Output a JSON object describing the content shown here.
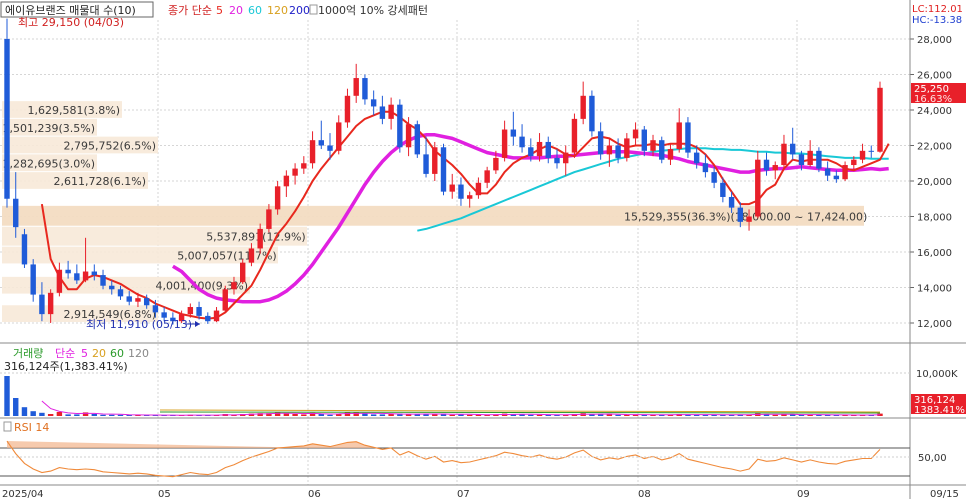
{
  "header": {
    "stock_name": "에이유브랜즈 매물대 수(10)",
    "ma_label": "종가 단순",
    "ma_periods": [
      "5",
      "20",
      "60",
      "120",
      "200"
    ],
    "ma_colors": [
      "#e8281e",
      "#e020e0",
      "#19c8d6",
      "#d8a020",
      "#2020c8"
    ],
    "pattern_label": "1000억 10% 강세패턴",
    "lc": "LC:112.01",
    "hc": "HC:-13.38"
  },
  "annotations": {
    "high": "최고 29,150 (04/03)",
    "low": "최저 11,910 (05/13)"
  },
  "price_panel": {
    "current_price": "25,250",
    "current_change": "16.63%",
    "y_ticks": [
      "28,000",
      "26,000",
      "24,000",
      "22,000",
      "20,000",
      "18,000",
      "16,000",
      "14,000",
      "12,000"
    ]
  },
  "volume_profile": [
    {
      "label": "1,629,581(3.8%)",
      "lo": 23500,
      "hi": 24500,
      "highlight": false
    },
    {
      "label": "1,501,239(3.5%)",
      "lo": 22500,
      "hi": 23500,
      "highlight": false
    },
    {
      "label": "2,795,752(6.5%)",
      "lo": 21500,
      "hi": 22500,
      "highlight": false
    },
    {
      "label": "1,282,695(3.0%)",
      "lo": 20500,
      "hi": 21500,
      "highlight": false
    },
    {
      "label": "2,611,728(6.1%)",
      "lo": 19500,
      "hi": 20500,
      "highlight": false
    },
    {
      "label": "15,529,355(36.3%)(18,000.00 ~ 17,424.00)",
      "lo": 17424,
      "hi": 18600,
      "highlight": true
    },
    {
      "label": "5,537,891(12.9%)",
      "lo": 16300,
      "hi": 17424,
      "highlight": false
    },
    {
      "label": "5,007,057(11.7%)",
      "lo": 15300,
      "hi": 16300,
      "highlight": false
    },
    {
      "label": "4,001,400(9.3%)",
      "lo": 13600,
      "hi": 14600,
      "highlight": false
    },
    {
      "label": "2,914,549(6.8%)",
      "lo": 12000,
      "hi": 13000,
      "highlight": false
    }
  ],
  "volume_panel": {
    "title": "거래량",
    "ma_label": "단순",
    "ma_periods": [
      "5",
      "20",
      "60",
      "120"
    ],
    "ma_colors": [
      "#e020e0",
      "#d8a020",
      "#2a9a2a",
      "#888888"
    ],
    "current": "316,124주(1,383.41%)",
    "y_tick": "10,000K",
    "badge_value": "316,124",
    "badge_pct": "1383.41%"
  },
  "rsi_panel": {
    "title": "RSI 14",
    "y_tick": "50,00"
  },
  "x_axis": {
    "labels": [
      "2025/04",
      "05",
      "06",
      "07",
      "08",
      "09",
      "09/15"
    ]
  },
  "chart_data": {
    "type": "candlestick",
    "price_ylim": [
      11000,
      29500
    ],
    "candles": [
      {
        "o": 28000,
        "h": 29150,
        "l": 18500,
        "c": 19000
      },
      {
        "o": 19000,
        "h": 20500,
        "l": 16800,
        "c": 17400
      },
      {
        "o": 17000,
        "h": 17300,
        "l": 15100,
        "c": 15300
      },
      {
        "o": 15300,
        "h": 15600,
        "l": 13200,
        "c": 13600
      },
      {
        "o": 13600,
        "h": 14300,
        "l": 12100,
        "c": 12500
      },
      {
        "o": 12500,
        "h": 13900,
        "l": 12000,
        "c": 13700
      },
      {
        "o": 13700,
        "h": 15400,
        "l": 13500,
        "c": 15000
      },
      {
        "o": 15000,
        "h": 15500,
        "l": 14500,
        "c": 14800
      },
      {
        "o": 14800,
        "h": 15300,
        "l": 14200,
        "c": 14400
      },
      {
        "o": 14400,
        "h": 16800,
        "l": 14300,
        "c": 14900
      },
      {
        "o": 14900,
        "h": 15300,
        "l": 14400,
        "c": 14700
      },
      {
        "o": 14700,
        "h": 15000,
        "l": 13900,
        "c": 14100
      },
      {
        "o": 14100,
        "h": 14400,
        "l": 13600,
        "c": 13900
      },
      {
        "o": 13900,
        "h": 14100,
        "l": 13300,
        "c": 13500
      },
      {
        "o": 13500,
        "h": 13800,
        "l": 13000,
        "c": 13200
      },
      {
        "o": 13200,
        "h": 13700,
        "l": 12900,
        "c": 13400
      },
      {
        "o": 13400,
        "h": 13600,
        "l": 12800,
        "c": 13000
      },
      {
        "o": 13000,
        "h": 13300,
        "l": 12300,
        "c": 12600
      },
      {
        "o": 12600,
        "h": 12900,
        "l": 12100,
        "c": 12300
      },
      {
        "o": 12300,
        "h": 12600,
        "l": 11910,
        "c": 12100
      },
      {
        "o": 12100,
        "h": 12700,
        "l": 12000,
        "c": 12500
      },
      {
        "o": 12500,
        "h": 13100,
        "l": 12300,
        "c": 12900
      },
      {
        "o": 12900,
        "h": 13200,
        "l": 12200,
        "c": 12400
      },
      {
        "o": 12400,
        "h": 12600,
        "l": 11950,
        "c": 12100
      },
      {
        "o": 12100,
        "h": 12900,
        "l": 12050,
        "c": 12700
      },
      {
        "o": 12700,
        "h": 14100,
        "l": 12600,
        "c": 13900
      },
      {
        "o": 13900,
        "h": 14600,
        "l": 13600,
        "c": 14300
      },
      {
        "o": 14300,
        "h": 15600,
        "l": 14200,
        "c": 15400
      },
      {
        "o": 15400,
        "h": 16500,
        "l": 15200,
        "c": 16200
      },
      {
        "o": 16200,
        "h": 17600,
        "l": 15900,
        "c": 17300
      },
      {
        "o": 17300,
        "h": 18700,
        "l": 17100,
        "c": 18400
      },
      {
        "o": 18400,
        "h": 20000,
        "l": 18100,
        "c": 19700
      },
      {
        "o": 19700,
        "h": 20600,
        "l": 19100,
        "c": 20300
      },
      {
        "o": 20300,
        "h": 21000,
        "l": 19800,
        "c": 20700
      },
      {
        "o": 20700,
        "h": 21400,
        "l": 20400,
        "c": 21000
      },
      {
        "o": 21000,
        "h": 22800,
        "l": 20700,
        "c": 22300
      },
      {
        "o": 22300,
        "h": 23400,
        "l": 21800,
        "c": 22000
      },
      {
        "o": 22000,
        "h": 22700,
        "l": 21200,
        "c": 21700
      },
      {
        "o": 21700,
        "h": 23700,
        "l": 21500,
        "c": 23300
      },
      {
        "o": 23300,
        "h": 25200,
        "l": 23000,
        "c": 24800
      },
      {
        "o": 24800,
        "h": 26600,
        "l": 24400,
        "c": 25800
      },
      {
        "o": 25800,
        "h": 26000,
        "l": 24300,
        "c": 24600
      },
      {
        "o": 24600,
        "h": 25100,
        "l": 23700,
        "c": 24200
      },
      {
        "o": 24200,
        "h": 24800,
        "l": 23200,
        "c": 23500
      },
      {
        "o": 23500,
        "h": 24700,
        "l": 22900,
        "c": 24300
      },
      {
        "o": 24300,
        "h": 24600,
        "l": 21600,
        "c": 21900
      },
      {
        "o": 21900,
        "h": 23600,
        "l": 21400,
        "c": 23200
      },
      {
        "o": 23200,
        "h": 23400,
        "l": 21300,
        "c": 21500
      },
      {
        "o": 21500,
        "h": 22500,
        "l": 20200,
        "c": 20400
      },
      {
        "o": 20400,
        "h": 22200,
        "l": 20000,
        "c": 21900
      },
      {
        "o": 21900,
        "h": 22100,
        "l": 19200,
        "c": 19400
      },
      {
        "o": 19400,
        "h": 20400,
        "l": 19000,
        "c": 19800
      },
      {
        "o": 19800,
        "h": 20200,
        "l": 18600,
        "c": 19000
      },
      {
        "o": 19000,
        "h": 19400,
        "l": 18500,
        "c": 19200
      },
      {
        "o": 19200,
        "h": 20200,
        "l": 19000,
        "c": 19900
      },
      {
        "o": 19900,
        "h": 20800,
        "l": 19600,
        "c": 20600
      },
      {
        "o": 20600,
        "h": 21700,
        "l": 20400,
        "c": 21300
      },
      {
        "o": 21300,
        "h": 23400,
        "l": 21100,
        "c": 22900
      },
      {
        "o": 22900,
        "h": 23900,
        "l": 22000,
        "c": 22500
      },
      {
        "o": 22500,
        "h": 23200,
        "l": 21600,
        "c": 21900
      },
      {
        "o": 21900,
        "h": 22400,
        "l": 21100,
        "c": 21400
      },
      {
        "o": 21400,
        "h": 22700,
        "l": 21100,
        "c": 22200
      },
      {
        "o": 22200,
        "h": 22500,
        "l": 21000,
        "c": 21300
      },
      {
        "o": 21300,
        "h": 21800,
        "l": 20700,
        "c": 21000
      },
      {
        "o": 21000,
        "h": 22000,
        "l": 20300,
        "c": 21600
      },
      {
        "o": 21600,
        "h": 23800,
        "l": 21300,
        "c": 23500
      },
      {
        "o": 23500,
        "h": 25600,
        "l": 23200,
        "c": 24800
      },
      {
        "o": 24800,
        "h": 25100,
        "l": 22500,
        "c": 22800
      },
      {
        "o": 22800,
        "h": 23300,
        "l": 21200,
        "c": 21500
      },
      {
        "o": 21500,
        "h": 22400,
        "l": 20800,
        "c": 22000
      },
      {
        "o": 22000,
        "h": 22400,
        "l": 21000,
        "c": 21300
      },
      {
        "o": 21300,
        "h": 22700,
        "l": 21100,
        "c": 22400
      },
      {
        "o": 22400,
        "h": 23300,
        "l": 22000,
        "c": 22900
      },
      {
        "o": 22900,
        "h": 23100,
        "l": 21400,
        "c": 21700
      },
      {
        "o": 21700,
        "h": 22600,
        "l": 21400,
        "c": 22300
      },
      {
        "o": 22300,
        "h": 22500,
        "l": 21000,
        "c": 21200
      },
      {
        "o": 21200,
        "h": 22100,
        "l": 20900,
        "c": 21800
      },
      {
        "o": 21800,
        "h": 24100,
        "l": 21600,
        "c": 23300
      },
      {
        "o": 23300,
        "h": 23600,
        "l": 21300,
        "c": 21600
      },
      {
        "o": 21600,
        "h": 22000,
        "l": 20700,
        "c": 21000
      },
      {
        "o": 21000,
        "h": 21500,
        "l": 20200,
        "c": 20500
      },
      {
        "o": 20500,
        "h": 20800,
        "l": 19600,
        "c": 19900
      },
      {
        "o": 19900,
        "h": 20200,
        "l": 18800,
        "c": 19100
      },
      {
        "o": 19100,
        "h": 19400,
        "l": 18200,
        "c": 18500
      },
      {
        "o": 18500,
        "h": 18800,
        "l": 17400,
        "c": 17700
      },
      {
        "o": 17700,
        "h": 18400,
        "l": 17200,
        "c": 18000
      },
      {
        "o": 18000,
        "h": 21700,
        "l": 17900,
        "c": 21200
      },
      {
        "o": 21200,
        "h": 21600,
        "l": 20300,
        "c": 20600
      },
      {
        "o": 20600,
        "h": 21100,
        "l": 20100,
        "c": 20900
      },
      {
        "o": 20900,
        "h": 22600,
        "l": 20700,
        "c": 22100
      },
      {
        "o": 22100,
        "h": 23000,
        "l": 21200,
        "c": 21500
      },
      {
        "o": 21500,
        "h": 21700,
        "l": 20600,
        "c": 20900
      },
      {
        "o": 20900,
        "h": 22300,
        "l": 20800,
        "c": 21700
      },
      {
        "o": 21700,
        "h": 21900,
        "l": 20500,
        "c": 20700
      },
      {
        "o": 20700,
        "h": 21100,
        "l": 20000,
        "c": 20300
      },
      {
        "o": 20300,
        "h": 20600,
        "l": 19900,
        "c": 20100
      },
      {
        "o": 20100,
        "h": 21100,
        "l": 20000,
        "c": 20900
      },
      {
        "o": 20900,
        "h": 21400,
        "l": 20600,
        "c": 21200
      },
      {
        "o": 21200,
        "h": 22100,
        "l": 21000,
        "c": 21700
      },
      {
        "o": 21700,
        "h": 22000,
        "l": 21300,
        "c": 21650
      },
      {
        "o": 21650,
        "h": 25600,
        "l": 21600,
        "c": 25250
      }
    ],
    "ma5": [
      null,
      null,
      null,
      null,
      18700,
      15600,
      14600,
      13900,
      13900,
      14500,
      14700,
      14600,
      14400,
      14200,
      13900,
      13600,
      13400,
      13100,
      12900,
      12700,
      12500,
      12400,
      12300,
      12250,
      12300,
      12600,
      13100,
      13600,
      14100,
      15000,
      16000,
      17000,
      17600,
      18300,
      19100,
      20000,
      20700,
      21300,
      21900,
      22500,
      23100,
      23500,
      23700,
      23900,
      23900,
      23600,
      23200,
      22900,
      22400,
      21700,
      21300,
      20900,
      20400,
      19800,
      19300,
      19300,
      19800,
      20500,
      21000,
      21300,
      21500,
      21800,
      22000,
      21800,
      21500,
      21400,
      21900,
      22400,
      22500,
      22400,
      22100,
      21900,
      22000,
      22000,
      22100,
      22000,
      22100,
      22100,
      22100,
      21900,
      21500,
      20900,
      20100,
      19400,
      18700,
      18700,
      18900,
      19500,
      19800,
      20700,
      21200,
      21100,
      21200,
      21200,
      21200,
      21000,
      20700,
      20600,
      20800,
      21000,
      21200,
      22100
    ],
    "ma20": [
      null,
      null,
      null,
      null,
      null,
      null,
      null,
      null,
      null,
      null,
      null,
      null,
      null,
      null,
      null,
      null,
      null,
      null,
      null,
      15200,
      14900,
      14400,
      13900,
      13600,
      13400,
      13300,
      13250,
      13200,
      13200,
      13200,
      13300,
      13500,
      13800,
      14200,
      14700,
      15300,
      16000,
      16700,
      17400,
      18200,
      19000,
      19800,
      20500,
      21100,
      21600,
      22000,
      22300,
      22500,
      22600,
      22600,
      22500,
      22400,
      22200,
      22000,
      21800,
      21600,
      21500,
      21400,
      21300,
      21300,
      21300,
      21300,
      21350,
      21400,
      21400,
      21450,
      21500,
      21550,
      21600,
      21650,
      21650,
      21650,
      21600,
      21550,
      21500,
      21450,
      21350,
      21250,
      21100,
      21000,
      20900,
      20800,
      20700,
      20600,
      20500,
      20500,
      20600,
      20650,
      20700,
      20700,
      20750,
      20800,
      20750,
      20700,
      20650,
      20600,
      20600,
      20600,
      20650,
      20700,
      20650,
      20700
    ],
    "ma60_start": 47,
    "ma60": [
      17200,
      17300,
      17450,
      17600,
      17750,
      17900,
      18100,
      18300,
      18500,
      18700,
      18900,
      19100,
      19300,
      19500,
      19700,
      19900,
      20100,
      20300,
      20500,
      20650,
      20800,
      20950,
      21100,
      21250,
      21350,
      21450,
      21550,
      21650,
      21700,
      21750,
      21800,
      21850,
      21850,
      21850,
      21800,
      21800,
      21750,
      21750,
      21700,
      21650,
      21650,
      21600,
      21600,
      21550,
      21550,
      21500,
      21450,
      21400,
      21350,
      21300,
      21300,
      21300,
      21250,
      21250,
      21250
    ],
    "volume_norm": [
      1.0,
      0.45,
      0.22,
      0.12,
      0.08,
      0.05,
      0.1,
      0.04,
      0.04,
      0.09,
      0.05,
      0.03,
      0.03,
      0.03,
      0.02,
      0.03,
      0.02,
      0.02,
      0.02,
      0.02,
      0.02,
      0.03,
      0.02,
      0.02,
      0.02,
      0.05,
      0.03,
      0.05,
      0.06,
      0.07,
      0.07,
      0.09,
      0.06,
      0.05,
      0.04,
      0.08,
      0.05,
      0.03,
      0.06,
      0.09,
      0.1,
      0.06,
      0.04,
      0.04,
      0.05,
      0.06,
      0.05,
      0.04,
      0.05,
      0.05,
      0.06,
      0.03,
      0.04,
      0.03,
      0.03,
      0.03,
      0.04,
      0.06,
      0.04,
      0.04,
      0.03,
      0.03,
      0.03,
      0.03,
      0.03,
      0.05,
      0.07,
      0.05,
      0.04,
      0.04,
      0.03,
      0.03,
      0.04,
      0.03,
      0.03,
      0.03,
      0.03,
      0.05,
      0.04,
      0.03,
      0.03,
      0.03,
      0.03,
      0.03,
      0.04,
      0.03,
      0.07,
      0.04,
      0.03,
      0.04,
      0.04,
      0.03,
      0.03,
      0.03,
      0.03,
      0.02,
      0.03,
      0.02,
      0.03,
      0.02,
      0.06
    ],
    "rsi": [
      80,
      62,
      48,
      40,
      35,
      37,
      42,
      40,
      39,
      40,
      39,
      36,
      35,
      34,
      33,
      34,
      33,
      31,
      30,
      29,
      32,
      35,
      33,
      32,
      35,
      42,
      46,
      52,
      57,
      61,
      65,
      70,
      71,
      72,
      73,
      76,
      74,
      72,
      75,
      78,
      79,
      74,
      71,
      68,
      70,
      60,
      65,
      59,
      54,
      58,
      50,
      52,
      49,
      50,
      53,
      56,
      59,
      64,
      62,
      59,
      57,
      60,
      56,
      54,
      57,
      63,
      67,
      58,
      53,
      56,
      54,
      58,
      60,
      55,
      58,
      53,
      56,
      62,
      54,
      51,
      48,
      45,
      42,
      40,
      37,
      40,
      54,
      51,
      52,
      56,
      53,
      50,
      53,
      50,
      48,
      47,
      51,
      53,
      55,
      55,
      68
    ],
    "rsi_ylim": [
      20,
      90
    ]
  }
}
